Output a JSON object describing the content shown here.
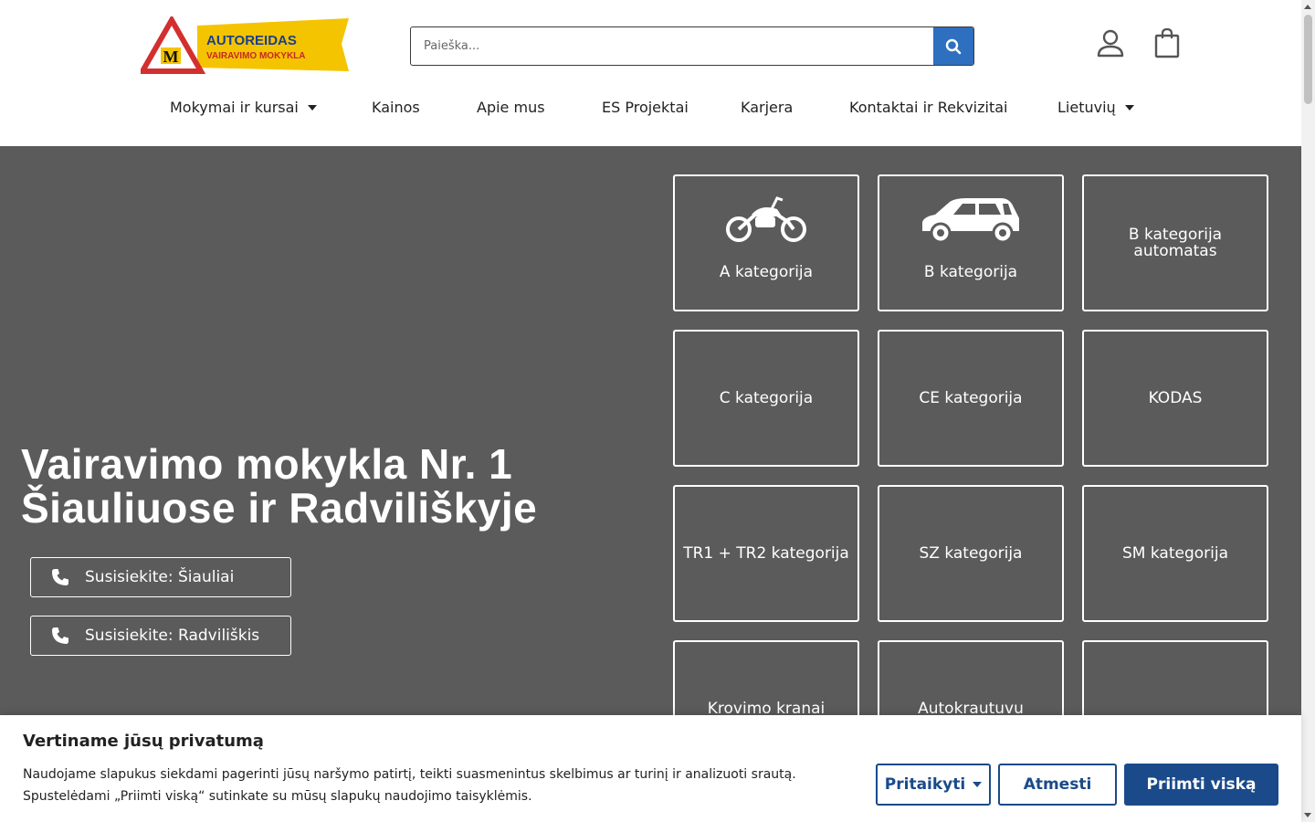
{
  "logo": {
    "brand": "AUTOREIDAS",
    "tagline": "VAIRAVIMO MOKYKLA",
    "emblem": "M"
  },
  "search": {
    "placeholder": "Paieška..."
  },
  "icons": {
    "search": "search-icon",
    "user": "user-icon",
    "cart": "shopping-bag-icon",
    "phone": "phone-icon",
    "motorcycle": "motorcycle-icon",
    "car": "car-icon"
  },
  "nav": {
    "items": [
      {
        "label": "Mokymai ir kursai",
        "dropdown": true
      },
      {
        "label": "Kainos"
      },
      {
        "label": "Apie mus"
      },
      {
        "label": "ES Projektai"
      },
      {
        "label": "Karjera"
      },
      {
        "label": "Kontaktai ir Rekvizitai"
      },
      {
        "label": "Lietuvių",
        "dropdown": true
      }
    ]
  },
  "hero": {
    "title_line1": "Vairavimo mokykla Nr. 1",
    "title_line2": "Šiauliuose ir Radviliškyje",
    "contact_siauliai": "Susisiekite: Šiauliai",
    "contact_radviliskis": "Susisiekite: Radviliškis"
  },
  "tiles": [
    {
      "label": "A kategorija",
      "icon": "motorcycle-icon"
    },
    {
      "label": "B kategorija",
      "icon": "car-icon"
    },
    {
      "label": "B kategorija automatas"
    },
    {
      "label": "C kategorija"
    },
    {
      "label": "CE kategorija"
    },
    {
      "label": "KODAS"
    },
    {
      "label": "TR1 + TR2 kategorija"
    },
    {
      "label": "SZ kategorija"
    },
    {
      "label": "SM kategorija"
    },
    {
      "label": "Krovimo kranai"
    },
    {
      "label": "Autokrautuvu"
    },
    {
      "label": ""
    }
  ],
  "cookie": {
    "title": "Vertiname jūsų privatumą",
    "text_line1": "Naudojame slapukus siekdami pagerinti jūsų naršymo patirtį, teikti suasmenintus skelbimus ar turinį ir analizuoti srautą.",
    "text_line2": "Spustelėdami „Priimti viską“ sutinkate su mūsų slapukų naudojimo taisyklėmis.",
    "customize_label": "Pritaikyti",
    "reject_label": "Atmesti",
    "accept_label": "Priimti viską"
  },
  "colors": {
    "hero_bg": "#5b5b5b",
    "accent_blue": "#1a4a8a",
    "search_blue": "#2f6fbf",
    "logo_yellow": "#f5c400",
    "logo_red": "#d32f2f"
  }
}
